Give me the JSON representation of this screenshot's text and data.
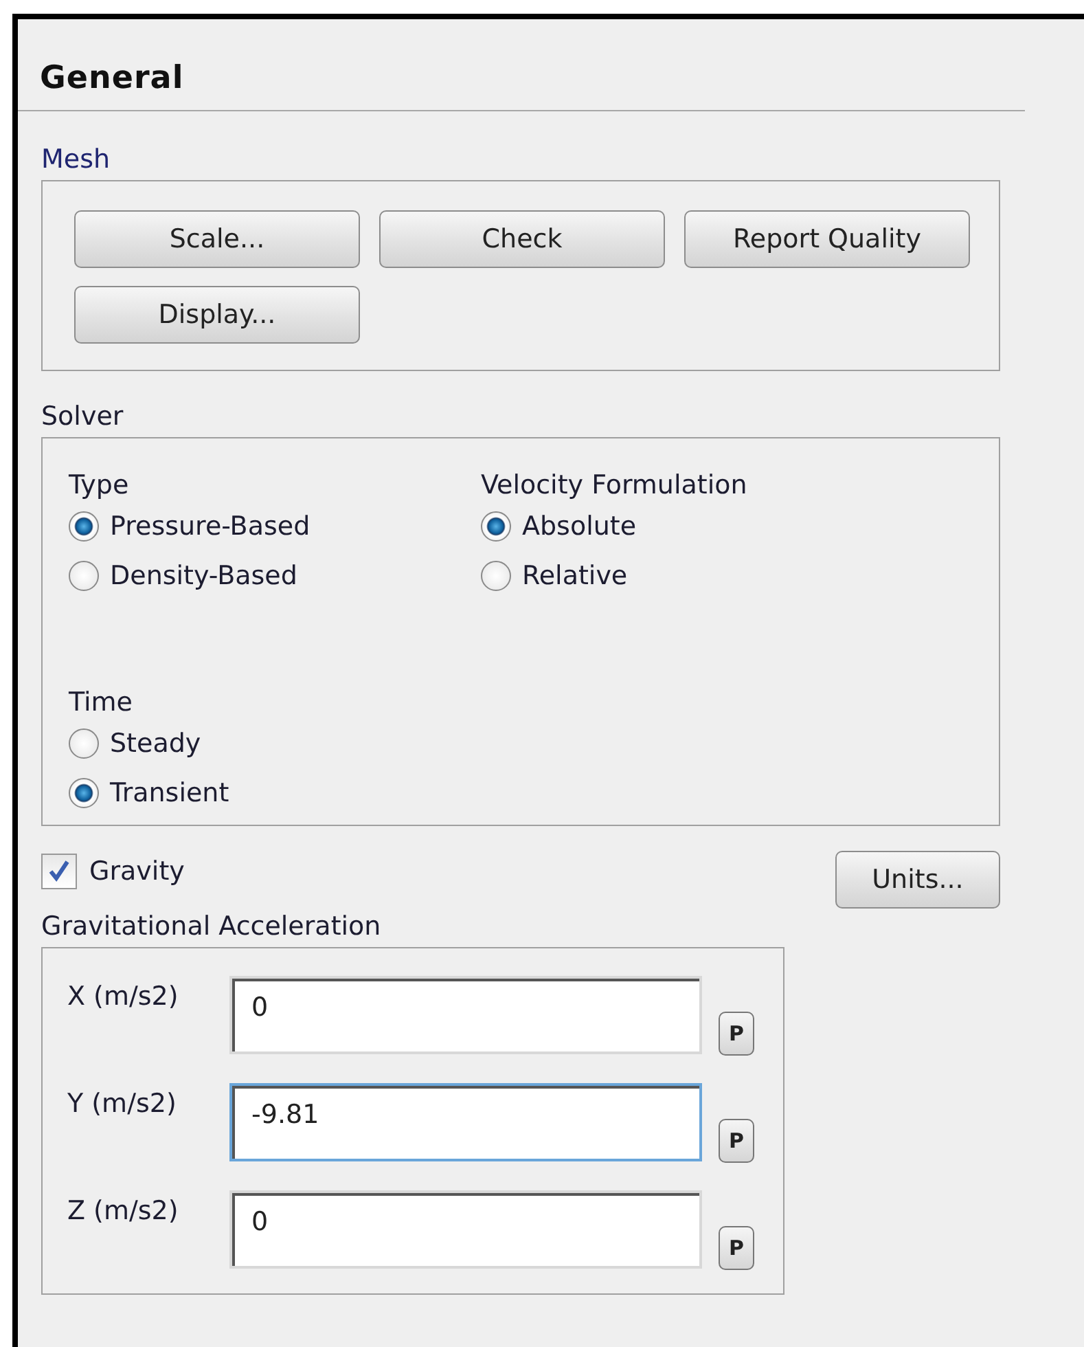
{
  "panel": {
    "title": "General"
  },
  "mesh": {
    "label": "Mesh",
    "buttons": [
      "Scale...",
      "Check",
      "Report Quality",
      "Display..."
    ]
  },
  "solver": {
    "label": "Solver",
    "groups": [
      {
        "label": "Type",
        "options": [
          {
            "label": "Pressure-Based",
            "selected": true
          },
          {
            "label": "Density-Based",
            "selected": false
          }
        ]
      },
      {
        "label": "Velocity Formulation",
        "options": [
          {
            "label": "Absolute",
            "selected": true
          },
          {
            "label": "Relative",
            "selected": false
          }
        ]
      },
      {
        "label": "Time",
        "options": [
          {
            "label": "Steady",
            "selected": false
          },
          {
            "label": "Transient",
            "selected": true
          }
        ]
      }
    ]
  },
  "gravity": {
    "label": "Gravity",
    "checked": true
  },
  "units_button": "Units...",
  "acceleration": {
    "label": "Gravitational Acceleration",
    "fields": [
      {
        "label": "X (m/s2)",
        "value": "0",
        "focused": false,
        "param_button": "P"
      },
      {
        "label": "Y (m/s2)",
        "value": "-9.81",
        "focused": true,
        "param_button": "P"
      },
      {
        "label": "Z (m/s2)",
        "value": "0",
        "focused": false,
        "param_button": "P"
      }
    ]
  }
}
